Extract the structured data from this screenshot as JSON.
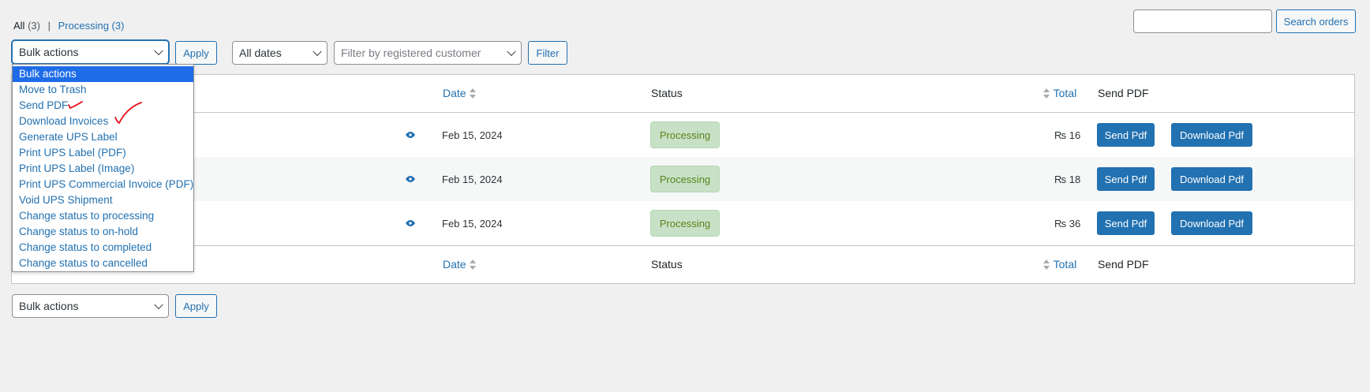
{
  "filters": {
    "views": [
      {
        "label": "All",
        "count": "(3)"
      },
      {
        "label": "Processing",
        "count": "(3)"
      }
    ],
    "separator": "|",
    "search_button": "Search orders",
    "bulk_actions_top": "Bulk actions",
    "apply_top": "Apply",
    "dates": "All dates",
    "customer_placeholder": "Filter by registered customer",
    "filter_button": "Filter",
    "bulk_actions_bottom": "Bulk actions",
    "apply_bottom": "Apply"
  },
  "bulk_menu": {
    "options": [
      "Bulk actions",
      "Move to Trash",
      "Send PDF",
      "Download Invoices",
      "Generate UPS Label",
      "Print UPS Label (PDF)",
      "Print UPS Label (Image)",
      "Print UPS Commercial Invoice (PDF)",
      "Void UPS Shipment",
      "Change status to processing",
      "Change status to on-hold",
      "Change status to completed",
      "Change status to cancelled"
    ],
    "selected": "Bulk actions"
  },
  "table": {
    "columns": {
      "date": "Date",
      "status": "Status",
      "total": "Total",
      "send_pdf": "Send PDF"
    },
    "rows": [
      {
        "date": "Feb 15, 2024",
        "status": "Processing",
        "total": "₨ 16",
        "send": "Send Pdf",
        "download": "Download Pdf"
      },
      {
        "date": "Feb 15, 2024",
        "status": "Processing",
        "total": "₨ 18",
        "send": "Send Pdf",
        "download": "Download Pdf"
      },
      {
        "date": "Feb 15, 2024",
        "status": "Processing",
        "total": "₨ 36",
        "send": "Send Pdf",
        "download": "Download Pdf"
      }
    ]
  },
  "colors": {
    "accent": "#2271b1",
    "status_bg": "#c6e1c6",
    "status_text": "#5b841b",
    "annotation": "#e8101a"
  }
}
